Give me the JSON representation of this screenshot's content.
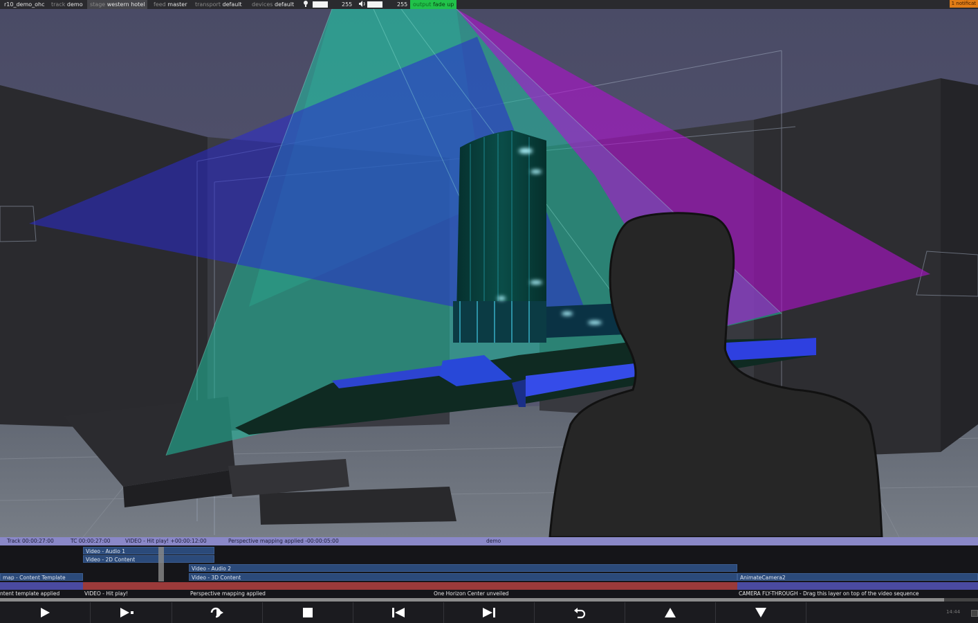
{
  "topbar": {
    "project": "r10_demo_ohc",
    "track_key": "track",
    "track_val": "demo",
    "stage_key": "stage",
    "stage_val": "western hotel",
    "feed_key": "feed",
    "feed_val": "master",
    "transport_key": "transport",
    "transport_val": "default",
    "devices_key": "devices",
    "devices_val": "default",
    "bulb_icon": "bulb-icon",
    "light_level": "255",
    "speaker_icon": "speaker-icon",
    "volume_level": "255",
    "output_key": "output",
    "output_val": "fade up",
    "notification": "1 notificat"
  },
  "timeline": {
    "header": {
      "track_tc": "Track 00:00:27:00",
      "tc": "TC 00:00:27:00",
      "video_cue": "VIDEO - Hit play! +00:00:12:00",
      "mapping_cue": "Perspective mapping applied -00:00:05:00",
      "name": "demo"
    },
    "layers": {
      "audio1": "Video - Audio 1",
      "content2d": "Video - 2D Content",
      "audio2": "Video - Audio 2",
      "content3d": "Video - 3D Content",
      "content_template": "map - Content Template",
      "animate_camera": "AnimateCamera2"
    },
    "cues": {
      "c1": "ntent template applied",
      "c2": "VIDEO - Hit play!",
      "c3": "Perspective mapping applied",
      "c4": "One Horizon Center unveiled",
      "c5": "CAMERA FLY-THROUGH - Drag this layer on top of the video sequence"
    }
  },
  "controls": {
    "play": "play-icon",
    "play_section": "play-to-marker-icon",
    "loop": "loop-icon",
    "stop": "stop-icon",
    "prev": "previous-icon",
    "next": "next-icon",
    "undo": "return-icon",
    "up": "up-arrow-icon",
    "down": "down-arrow-icon",
    "clock": "14:44"
  },
  "colors": {
    "beam_green": "#20c0a0",
    "beam_blue": "#2a2ad0",
    "beam_magenta": "#b010d0",
    "output_active": "#21c24a",
    "notification": "#e07c16",
    "timeline_header": "#8a88c8",
    "cue_red": "#9b3a3a"
  }
}
